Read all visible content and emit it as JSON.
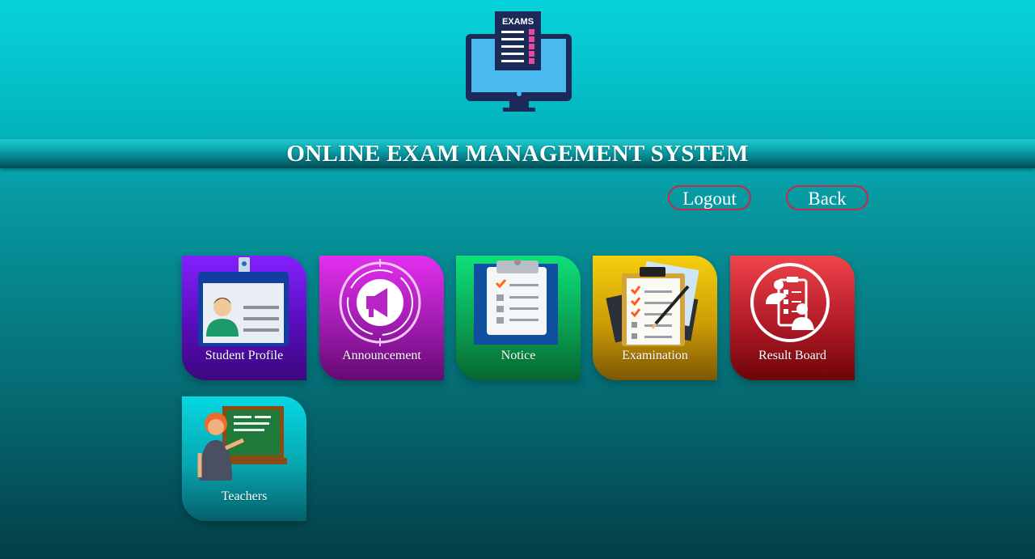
{
  "header": {
    "logo_text": "EXAMS",
    "title": "ONLINE EXAM MANAGEMENT SYSTEM"
  },
  "nav": {
    "logout_label": "Logout",
    "back_label": "Back"
  },
  "tiles": [
    {
      "label": "Student Profile",
      "icon": "id-card-icon"
    },
    {
      "label": "Announcement",
      "icon": "megaphone-icon"
    },
    {
      "label": "Notice",
      "icon": "clipboard-icon"
    },
    {
      "label": "Examination",
      "icon": "exam-checklist-icon"
    },
    {
      "label": "Result Board",
      "icon": "result-board-icon"
    },
    {
      "label": "Teachers",
      "icon": "teacher-icon"
    }
  ],
  "colors": {
    "accent_border": "#c42a4a",
    "background_top": "#06d3db",
    "background_bottom": "#033f48"
  }
}
